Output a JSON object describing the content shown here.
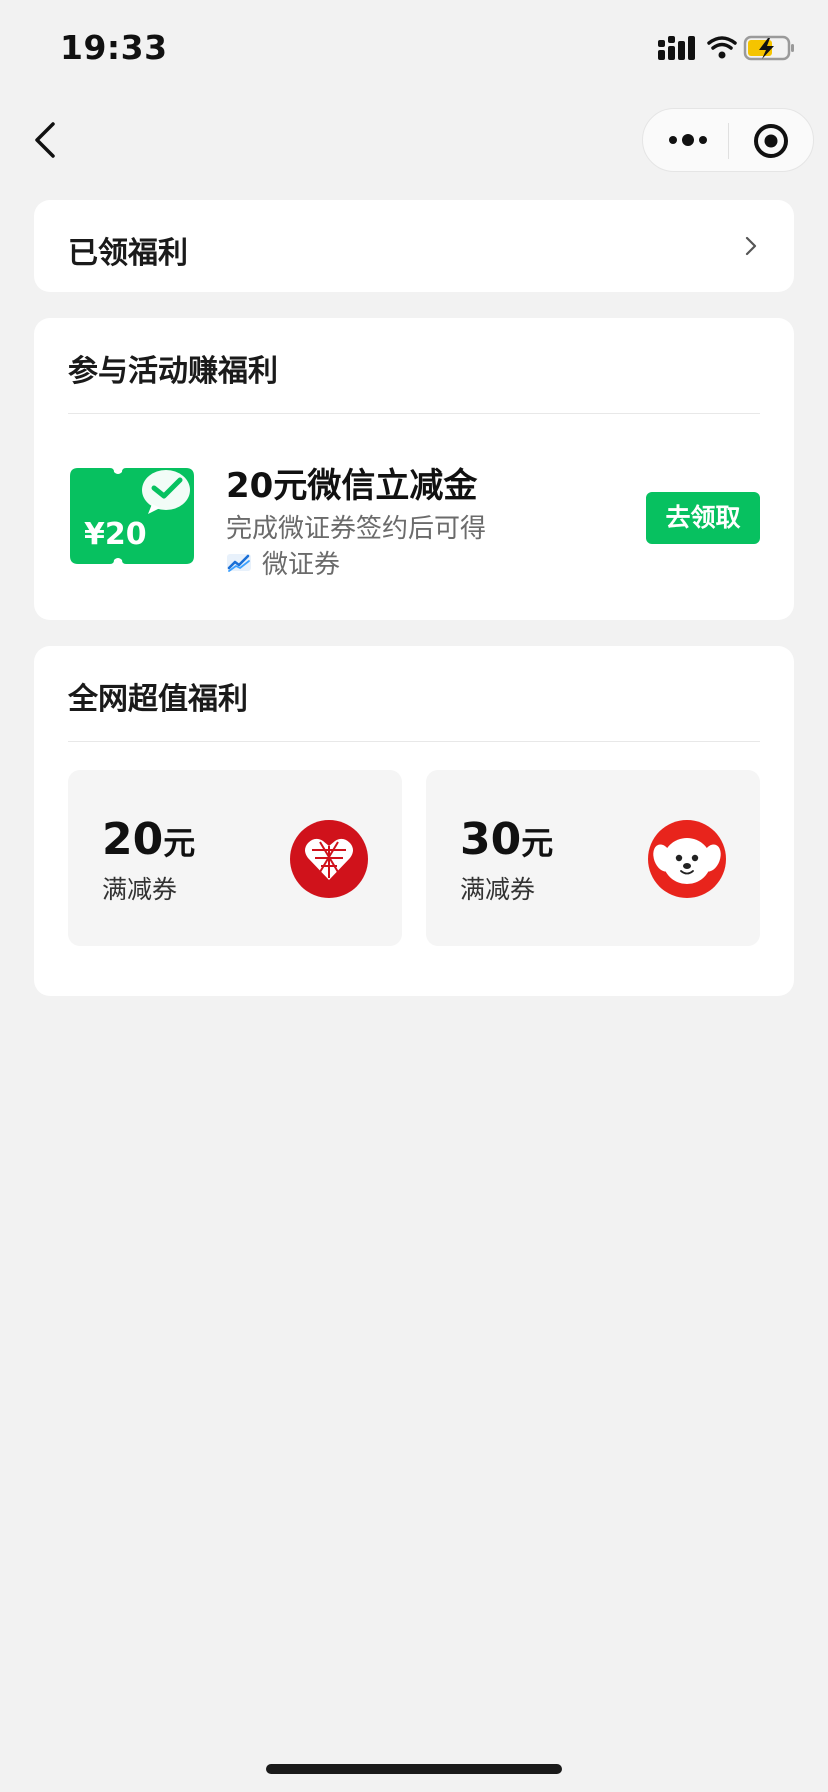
{
  "status_bar": {
    "time": "19:33",
    "icons": [
      "cellular-signal-icon",
      "wifi-icon",
      "battery-charging-icon"
    ]
  },
  "nav": {
    "back_icon": "chevron-left-icon",
    "capsule_icons": [
      "more-dots-icon",
      "target-icon"
    ]
  },
  "claimed": {
    "title": "已领福利",
    "icon": "chevron-right-icon"
  },
  "activity": {
    "section_title": "参与活动赚福利",
    "item": {
      "title": "20元微信立减金",
      "description": "完成微证券签约后可得",
      "brand_name": "微证券",
      "voucher_amount": "¥20",
      "button_label": "去领取"
    }
  },
  "deals": {
    "section_title": "全网超值福利",
    "coupons": [
      {
        "amount": "20",
        "unit": "元",
        "kind": "满减券",
        "logo": "pinduoduo-logo"
      },
      {
        "amount": "30",
        "unit": "元",
        "kind": "满减券",
        "logo": "jd-logo"
      }
    ]
  },
  "colors": {
    "background": "#f2f2f2",
    "card": "#ffffff",
    "accent_green": "#07c160",
    "coupon_bg": "#f5f5f5",
    "pdd_red": "#d0121b",
    "jd_red": "#e8241c"
  }
}
